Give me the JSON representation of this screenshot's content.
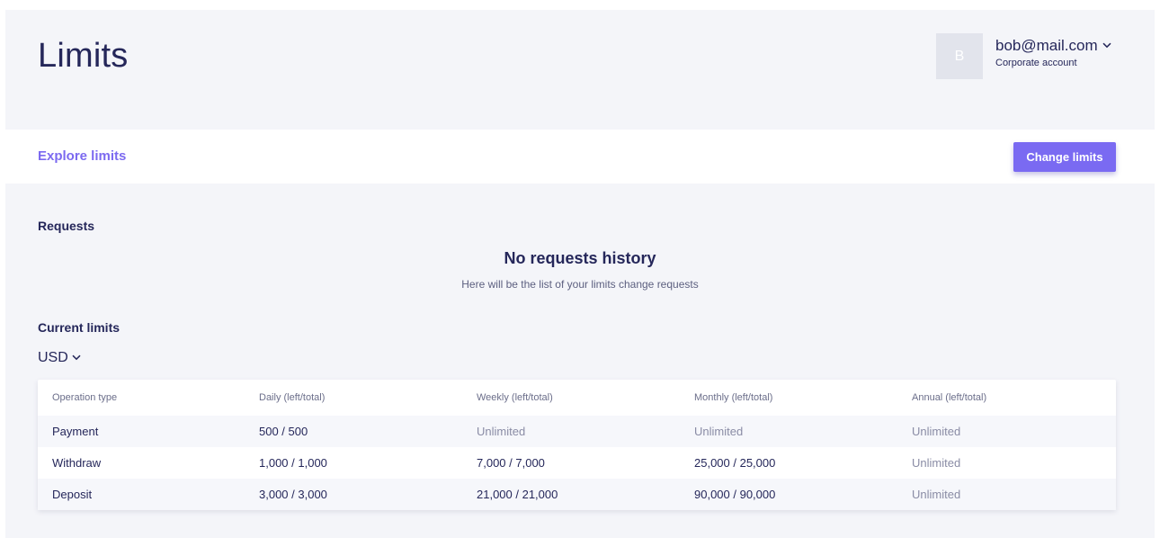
{
  "header": {
    "title": "Limits",
    "avatar_initial": "B",
    "user_email": "bob@mail.com",
    "account_type": "Corporate account",
    "dropdown_icon": "chevron-down-icon"
  },
  "explore": {
    "link_label": "Explore limits",
    "button_label": "Change limits"
  },
  "requests": {
    "title": "Requests",
    "empty_title": "No requests history",
    "empty_subtitle": "Here will be the list of your limits change requests"
  },
  "current_limits": {
    "title": "Current limits",
    "currency": "USD",
    "columns": [
      "Operation type",
      "Daily (left/total)",
      "Weekly (left/total)",
      "Monthly (left/total)",
      "Annual (left/total)"
    ],
    "rows": [
      [
        "Payment",
        "500 / 500",
        "Unlimited",
        "Unlimited",
        "Unlimited"
      ],
      [
        "Withdraw",
        "1,000 / 1,000",
        "7,000 / 7,000",
        "25,000 / 25,000",
        "Unlimited"
      ],
      [
        "Deposit",
        "3,000 / 3,000",
        "21,000 / 21,000",
        "90,000 / 90,000",
        "Unlimited"
      ]
    ]
  },
  "colors": {
    "accent": "#7a6af2",
    "text": "#25275a",
    "background": "#f4f5f9"
  }
}
